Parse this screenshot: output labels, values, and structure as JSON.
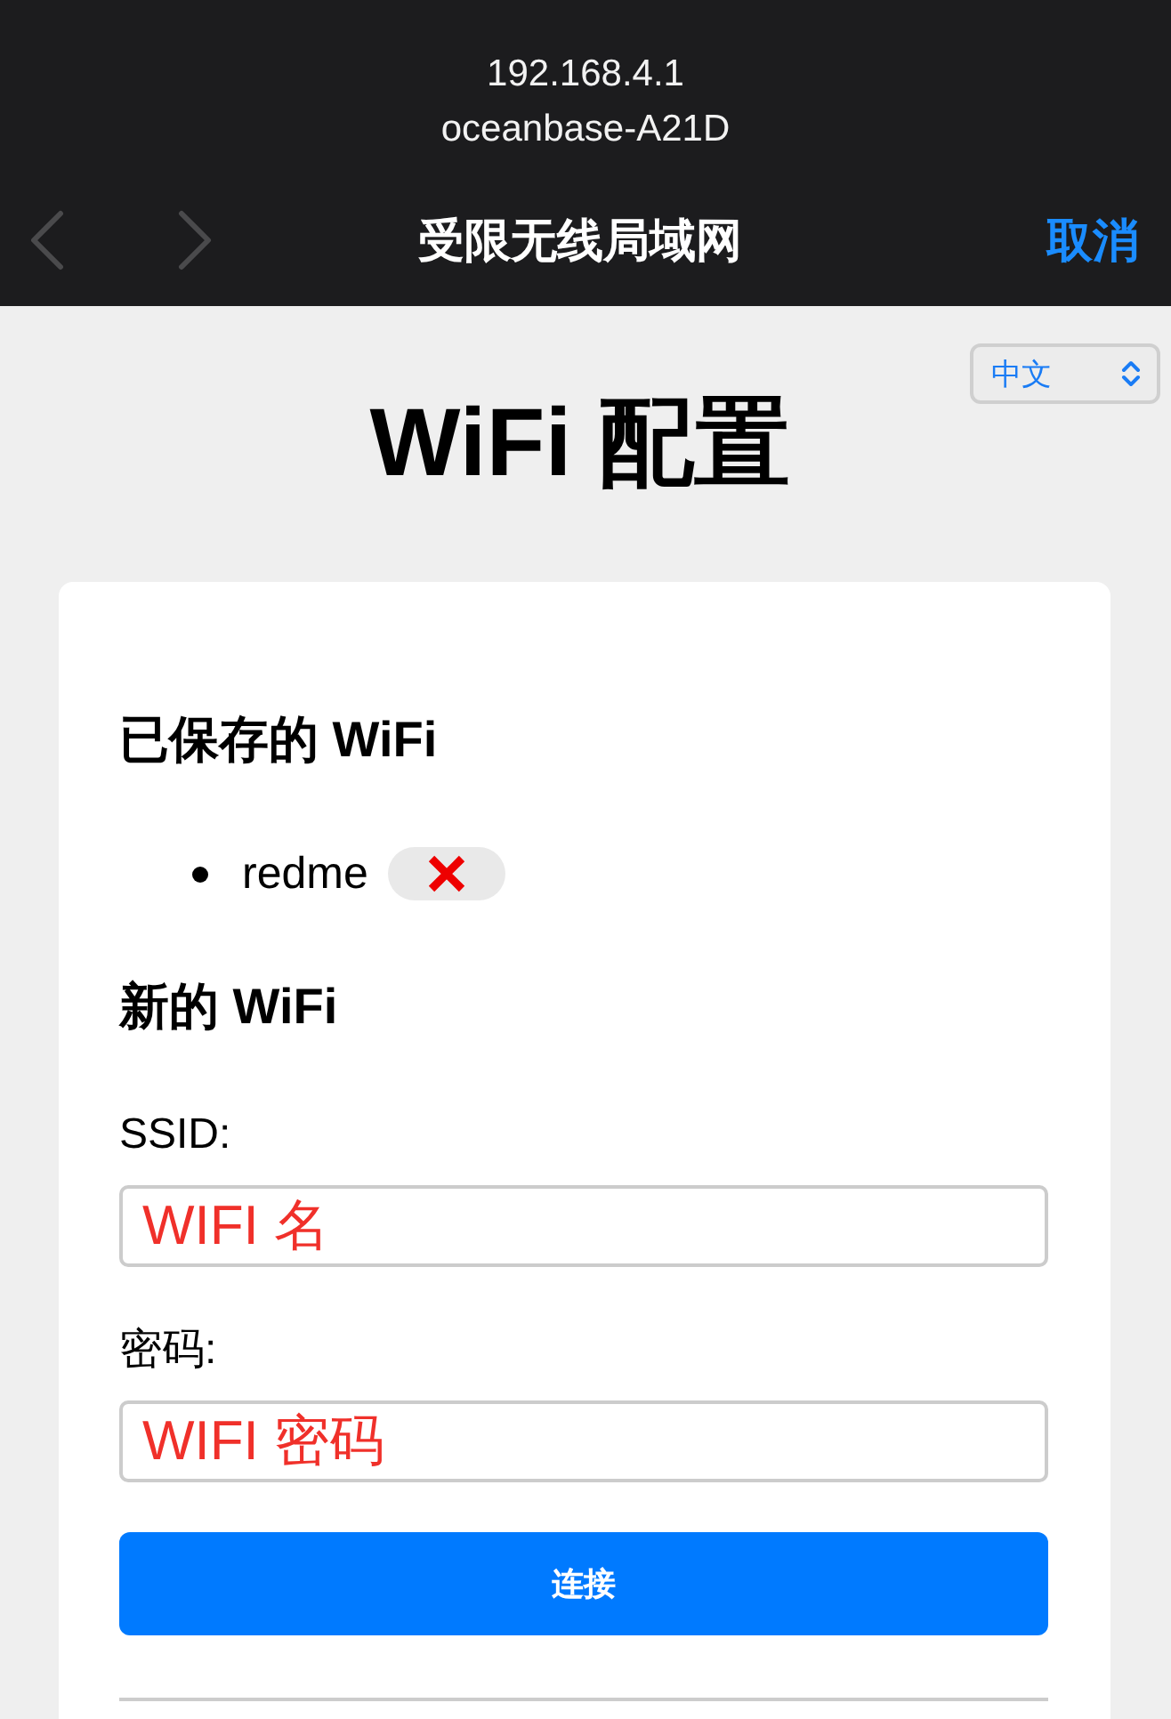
{
  "browser_bar": {
    "url": "192.168.4.1",
    "network": "oceanbase-A21D",
    "back_button": {
      "disabled": true
    },
    "forward_button": {
      "disabled": true
    },
    "title": "受限无线局域网",
    "cancel": "取消"
  },
  "language_select": {
    "value": "中文"
  },
  "page_title": "WiFi 配置",
  "saved_section": {
    "heading": "已保存的 WiFi",
    "networks": [
      {
        "name": "redme"
      }
    ]
  },
  "new_section": {
    "heading": "新的 WiFi",
    "fields": [
      {
        "label": "SSID:",
        "value": "WIFI 名"
      },
      {
        "label": "密码:",
        "value": "WIFI 密码"
      }
    ],
    "connect_button": "连接"
  }
}
